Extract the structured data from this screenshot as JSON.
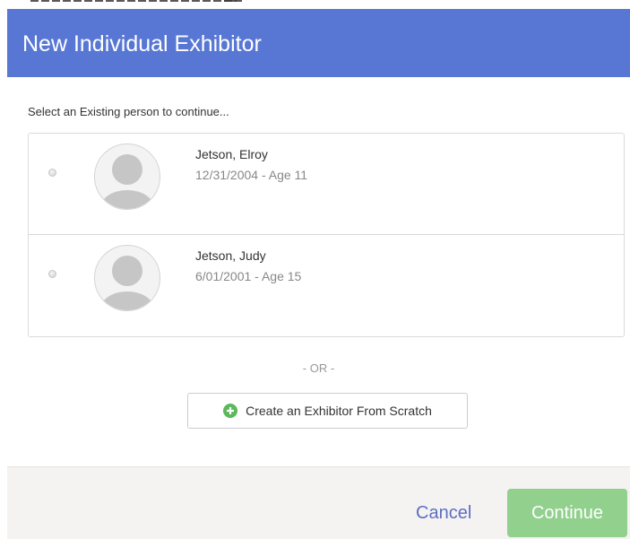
{
  "modal": {
    "title": "New Individual Exhibitor",
    "prompt": "Select an Existing person to continue...",
    "or_divider": "- OR -",
    "create_button_label": "Create an Exhibitor From Scratch",
    "cancel_label": "Cancel",
    "continue_label": "Continue"
  },
  "people": [
    {
      "name": "Jetson, Elroy",
      "dob_age": "12/31/2004 - Age 11",
      "selected": false
    },
    {
      "name": "Jetson, Judy",
      "dob_age": "6/01/2001 - Age 15",
      "selected": false
    }
  ],
  "icons": {
    "avatar": "person-silhouette-icon",
    "create": "plus-circle-icon",
    "radio": "radio-unchecked"
  },
  "colors": {
    "header_bg": "#5877d4",
    "continue_bg": "#92d08e",
    "plus_icon": "#5cb85c",
    "cancel_link": "#5b6fc4",
    "footer_bg": "#f5f3f1"
  }
}
